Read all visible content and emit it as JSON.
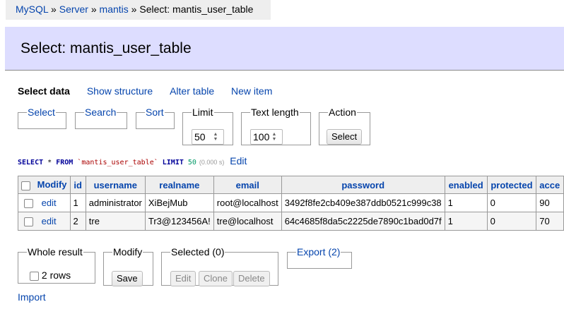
{
  "breadcrumb": {
    "items": [
      "MySQL",
      "Server",
      "mantis"
    ],
    "separator": "»",
    "current": "Select: mantis_user_table"
  },
  "page_title": "Select: mantis_user_table",
  "menu": {
    "items": [
      "Select data",
      "Show structure",
      "Alter table",
      "New item"
    ]
  },
  "filters": {
    "select_legend": "Select",
    "search_legend": "Search",
    "sort_legend": "Sort",
    "limit_legend": "Limit",
    "limit_value": "50",
    "text_length_legend": "Text length",
    "text_length_value": "100",
    "action_legend": "Action",
    "action_button": "Select"
  },
  "sql": {
    "kw_select": "SELECT",
    "star": "*",
    "kw_from": "FROM",
    "table": "`mantis_user_table`",
    "kw_limit": "LIMIT",
    "limit": "50",
    "time": "(0.000 s)",
    "edit_label": "Edit"
  },
  "table": {
    "modify_header": "Modify",
    "columns": [
      "id",
      "username",
      "realname",
      "email",
      "password",
      "enabled",
      "protected",
      "acce"
    ],
    "rows": [
      {
        "edit": "edit",
        "cells": [
          "1",
          "administrator",
          "XiBejMub",
          "root@localhost",
          "3492f8fe2cb409e387ddb0521c999c38",
          "1",
          "0",
          "90"
        ]
      },
      {
        "edit": "edit",
        "cells": [
          "2",
          "tre",
          "Tr3@123456A!",
          "tre@localhost",
          "64c4685f8da5c2225de7890c1bad0d7f",
          "1",
          "0",
          "70"
        ]
      }
    ]
  },
  "bottom": {
    "whole_result_legend": "Whole result",
    "rows_label": "2 rows",
    "modify_legend": "Modify",
    "save_button": "Save",
    "selected_legend": "Selected (0)",
    "edit_button": "Edit",
    "clone_button": "Clone",
    "delete_button": "Delete",
    "export_legend": "Export (2)"
  },
  "import_link": "Import",
  "colors": {
    "link": "#0645ad",
    "header_band": "#ddddff",
    "breadcrumb_bg": "#eeeeee"
  }
}
